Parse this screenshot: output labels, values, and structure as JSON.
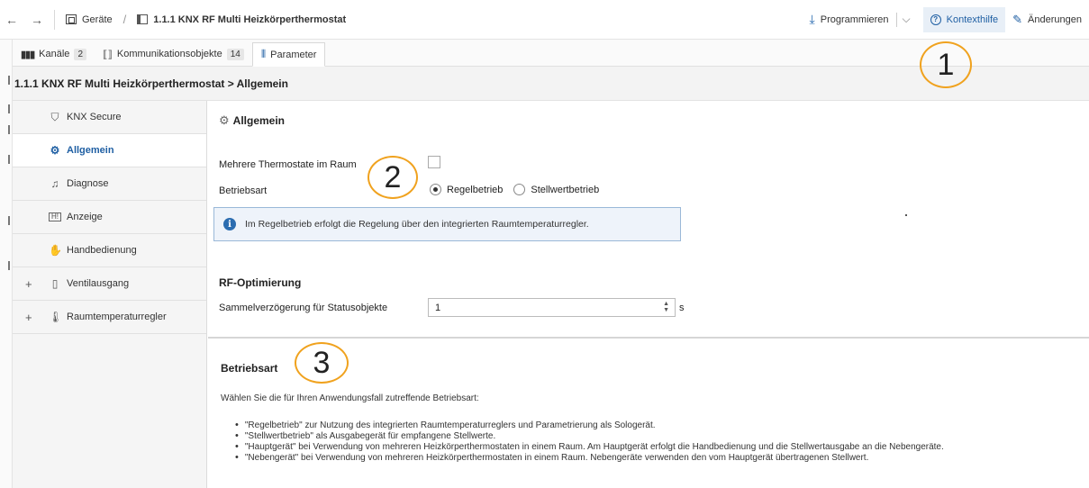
{
  "topbar": {
    "breadcrumb_root": "Geräte",
    "breadcrumb_device": "1.1.1 KNX RF Multi Heizkörperthermostat",
    "program_label": "Programmieren",
    "help_label": "Kontexthilfe",
    "changes_label": "Änderungen"
  },
  "tabs": [
    {
      "label": "Kanäle",
      "count": "2"
    },
    {
      "label": "Kommunikationsobjekte",
      "count": "14"
    },
    {
      "label": "Parameter"
    }
  ],
  "path": "1.1.1 KNX RF Multi Heizkörperthermostat > Allgemein",
  "sidebar": {
    "items": [
      {
        "label": "KNX Secure",
        "icon": "shield-icon"
      },
      {
        "label": "Allgemein",
        "icon": "gear-icon"
      },
      {
        "label": "Diagnose",
        "icon": "bell-icon"
      },
      {
        "label": "Anzeige",
        "icon": "display-icon"
      },
      {
        "label": "Handbedienung",
        "icon": "hand-icon"
      },
      {
        "label": "Ventilausgang",
        "icon": "valve-icon",
        "expand": "+"
      },
      {
        "label": "Raumtemperaturregler",
        "icon": "thermometer-icon",
        "expand": "+"
      }
    ]
  },
  "main": {
    "section_title": "Allgemein",
    "multi_thermostat_label": "Mehrere Thermostate im Raum",
    "mode_label": "Betriebsart",
    "mode_options": [
      "Regelbetrieb",
      "Stellwertbetrieb"
    ],
    "mode_selected": "Regelbetrieb",
    "info_text": "Im Regelbetrieb erfolgt die Regelung über den integrierten Raumtemperaturregler.",
    "rf_title": "RF-Optimierung",
    "delay_label": "Sammelverzögerung für Statusobjekte",
    "delay_value": "1",
    "delay_unit": "s"
  },
  "help": {
    "title": "Betriebsart",
    "intro": "Wählen Sie die für Ihren Anwendungsfall zutreffende Betriebsart:",
    "bullets": [
      "\"Regelbetrieb\" zur Nutzung des integrierten Raumtemperaturreglers und Parametrierung als Sologerät.",
      "\"Stellwertbetrieb\" als Ausgabegerät für empfangene Stellwerte.",
      "\"Hauptgerät\" bei Verwendung von mehreren Heizkörperthermostaten in einem Raum. Am Hauptgerät erfolgt die Handbedienung und die Stellwertausgabe an die Nebengeräte.",
      "\"Nebengerät\" bei Verwendung von mehreren Heizkörperthermostaten in einem Raum. Nebengeräte verwenden den vom Hauptgerät übertragenen Stellwert."
    ]
  },
  "callouts": [
    "1",
    "2",
    "3"
  ],
  "colors": {
    "accent": "#1f5fa3",
    "callout": "#f0a21e"
  }
}
